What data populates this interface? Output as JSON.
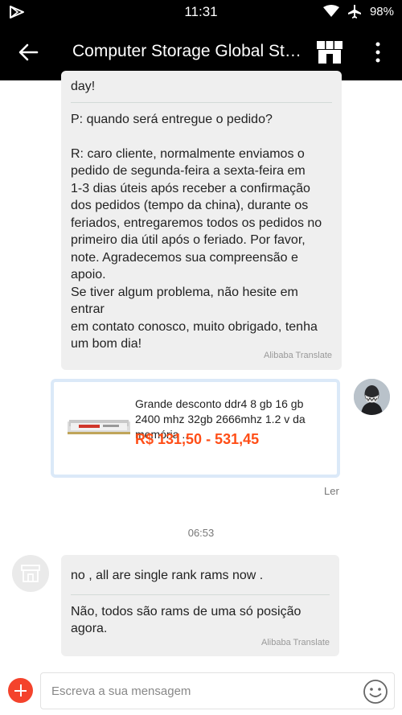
{
  "status_bar": {
    "time": "11:31",
    "battery": "98%"
  },
  "header": {
    "title": "Computer Storage Global Store...",
    "back_icon": "arrow-left-icon",
    "store_icon": "storefront-icon",
    "more_icon": "more-vertical-icon"
  },
  "messages": [
    {
      "sender": "store",
      "original": "day!",
      "translated": "P: quando será entregue o pedido?\n\nR: caro cliente, normalmente enviamos o\npedido de segunda-feira a sexta-feira em\n1-3 dias úteis após receber a confirmação\ndos pedidos (tempo da china), durante os\nferiados, entregaremos todos os pedidos no\nprimeiro dia útil após o feriado. Por favor,\nnote. Agradecemos sua compreensão e apoio.\nSe tiver algum problema, não hesite em entrar\nem contato conosco, muito obrigado, tenha\num bom dia!",
      "translate_label": "Alibaba Translate"
    },
    {
      "sender": "store",
      "original": "no , all are single rank rams now .",
      "translated": "Não, todos são rams de uma só posição agora.",
      "translate_label": "Alibaba Translate"
    }
  ],
  "product_card": {
    "title": "Grande desconto ddr4 8 gb 16 gb 2400 mhz 32gb 2666mhz 1.2 v da memória ...",
    "price": "R$ 131,50 - 531,45",
    "price_color": "#ff4e17"
  },
  "read_status": "Ler",
  "timestamp": "06:53",
  "composer": {
    "placeholder": "Escreva a sua mensagem",
    "add_icon": "plus-circle-icon",
    "emoji_icon": "smiley-icon"
  },
  "colors": {
    "header_bg": "#000000",
    "bubble_bg": "#efefef",
    "accent": "#f4432c",
    "card_border": "#dbe9f8"
  }
}
